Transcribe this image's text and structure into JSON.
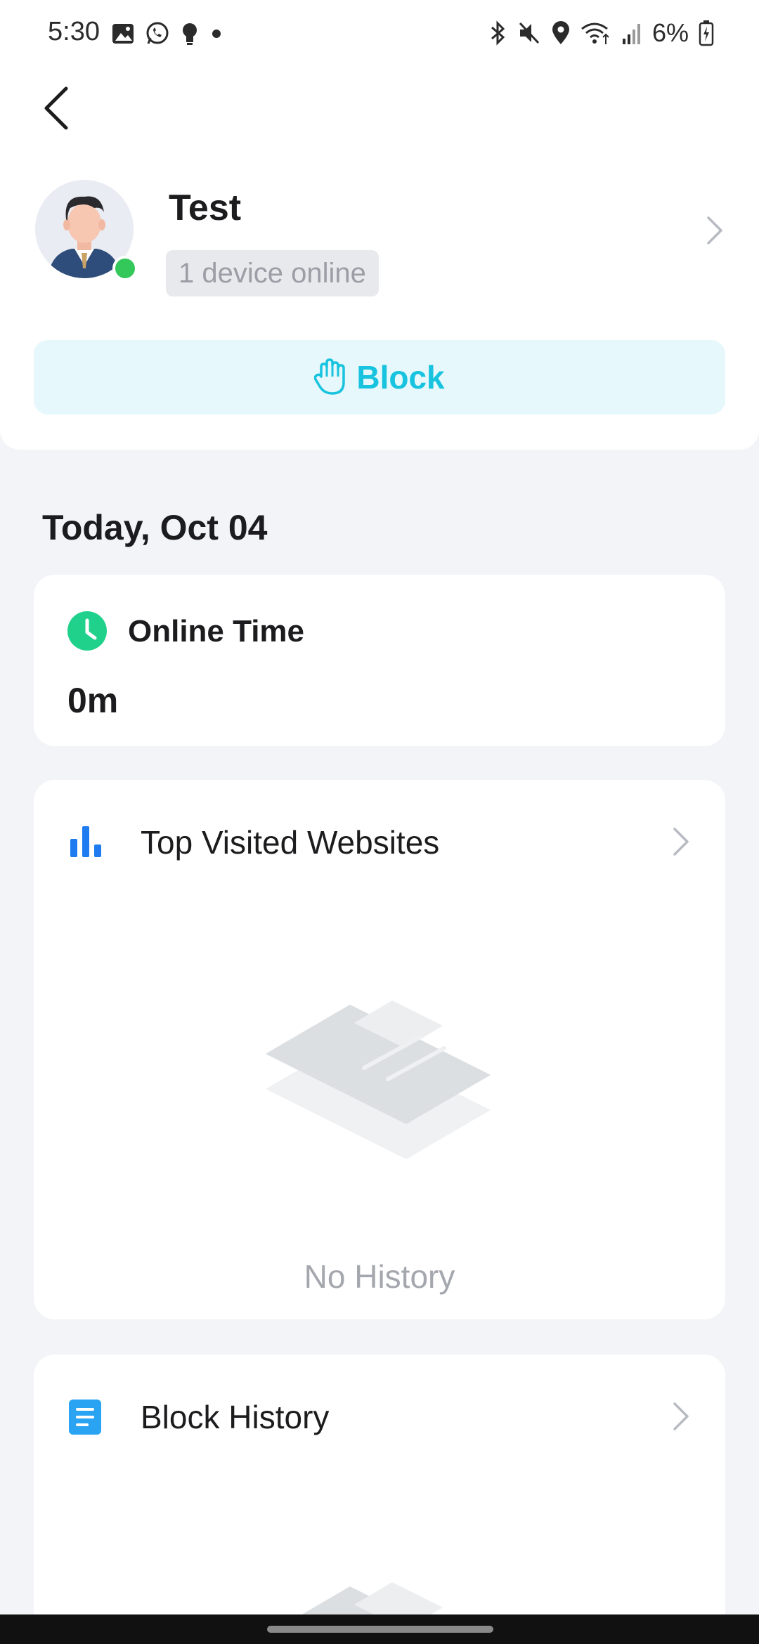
{
  "status_bar": {
    "time": "5:30",
    "battery": "6%",
    "left_icons": [
      "gallery-icon",
      "whatsapp-icon",
      "bulb-icon",
      "dot-icon"
    ],
    "right_icons": [
      "bluetooth-icon",
      "mute-icon",
      "location-icon",
      "wifi-icon",
      "signal-icon",
      "battery-icon"
    ]
  },
  "profile": {
    "name": "Test",
    "device_status": "1 device online",
    "block_label": "Block"
  },
  "date_heading": "Today, Oct 04",
  "online_time": {
    "title": "Online Time",
    "value": "0m"
  },
  "top_sites": {
    "title": "Top Visited Websites",
    "empty_text": "No History"
  },
  "block_history": {
    "title": "Block History"
  },
  "colors": {
    "accent": "#17c3de",
    "online_green": "#34c759",
    "clock_green": "#1fd18a",
    "chart_blue": "#1e7cf0",
    "history_blue": "#2aa3f2"
  }
}
